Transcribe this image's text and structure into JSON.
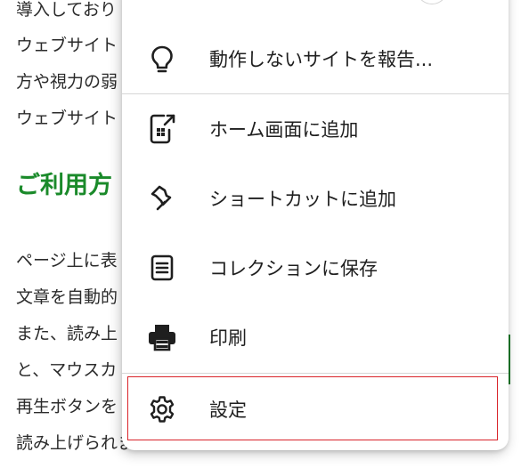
{
  "background": {
    "lines": [
      "導入しており",
      "ウェブサイト",
      "方や視力の弱",
      "ウェブサイト",
      "ページ上に表",
      "文章を自動的",
      "また、読み上",
      "と、マウスカ",
      "再生ボタンを",
      "読み上げられます。"
    ],
    "heading": "ご利用方",
    "accent_color": "#1a8a2a"
  },
  "menu": {
    "items": [
      {
        "label": "動作しないサイトを報告...",
        "icon": "lightbulb-icon"
      },
      {
        "label": "ホーム画面に追加",
        "icon": "add-to-home-screen-icon"
      },
      {
        "label": "ショートカットに追加",
        "icon": "pin-icon"
      },
      {
        "label": "コレクションに保存",
        "icon": "collections-icon"
      },
      {
        "label": "印刷",
        "icon": "printer-icon"
      },
      {
        "label": "設定",
        "icon": "gear-icon"
      }
    ],
    "highlight_color": "#d9232a"
  }
}
